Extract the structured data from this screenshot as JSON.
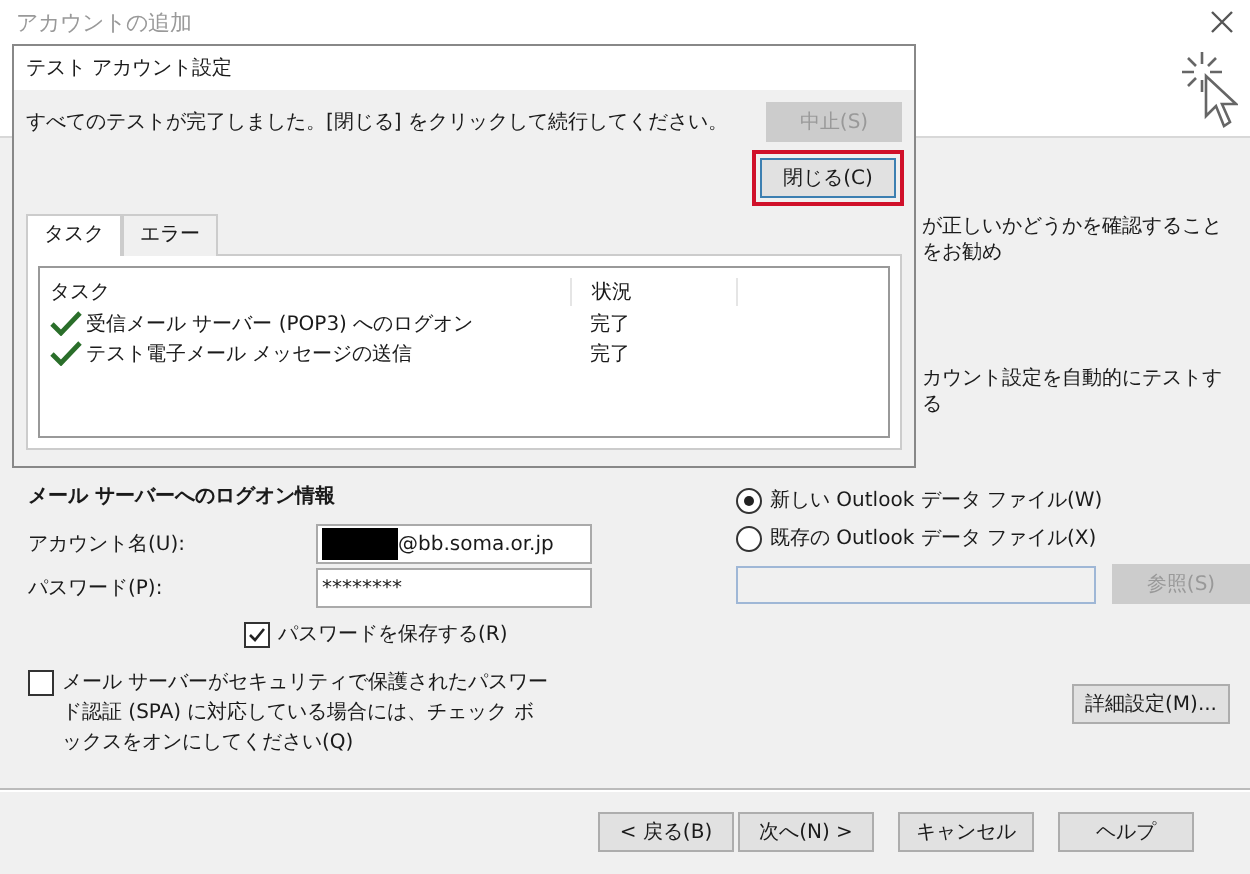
{
  "window": {
    "title": "アカウントの追加"
  },
  "background_texts": {
    "recommend": "が正しいかどうかを確認することをお勧め",
    "auto_test": "カウント設定を自動的にテストする"
  },
  "logon": {
    "heading": "メール サーバーへのログオン情報",
    "account_label": "アカウント名(U):",
    "account_value": "@bb.soma.or.jp",
    "account_redacted": true,
    "password_label": "パスワード(P):",
    "password_value": "********",
    "save_password": {
      "label": "パスワードを保存する(R)",
      "checked": true
    },
    "spa": {
      "label": "メール サーバーがセキュリティで保護されたパスワード認証 (SPA) に対応している場合には、チェック ボックスをオンにしてください(Q)",
      "checked": false
    }
  },
  "data_file": {
    "options": [
      {
        "label": "新しい Outlook データ ファイル(W)",
        "selected": true
      },
      {
        "label": "既存の Outlook データ ファイル(X)",
        "selected": false
      }
    ],
    "browse_button": {
      "label": "参照(S)",
      "disabled": true
    }
  },
  "advanced_button": "詳細設定(M)...",
  "footer_buttons": [
    "< 戻る(B)",
    "次へ(N) >",
    "キャンセル",
    "ヘルプ"
  ],
  "dialog": {
    "title": "テスト アカウント設定",
    "message": "すべてのテストが完了しました。[閉じる] をクリックして続行してください。",
    "stop_button": {
      "label": "中止(S)",
      "disabled": true
    },
    "close_button": {
      "label": "閉じる(C)",
      "highlighted": true
    },
    "tabs": [
      {
        "label": "タスク",
        "selected": true
      },
      {
        "label": "エラー",
        "selected": false
      }
    ],
    "table": {
      "columns": [
        "タスク",
        "状況"
      ],
      "rows": [
        {
          "task": "受信メール サーバー (POP3) へのログオン",
          "status": "完了",
          "done": true
        },
        {
          "task": "テスト電子メール メッセージの送信",
          "status": "完了",
          "done": true
        }
      ]
    }
  }
}
